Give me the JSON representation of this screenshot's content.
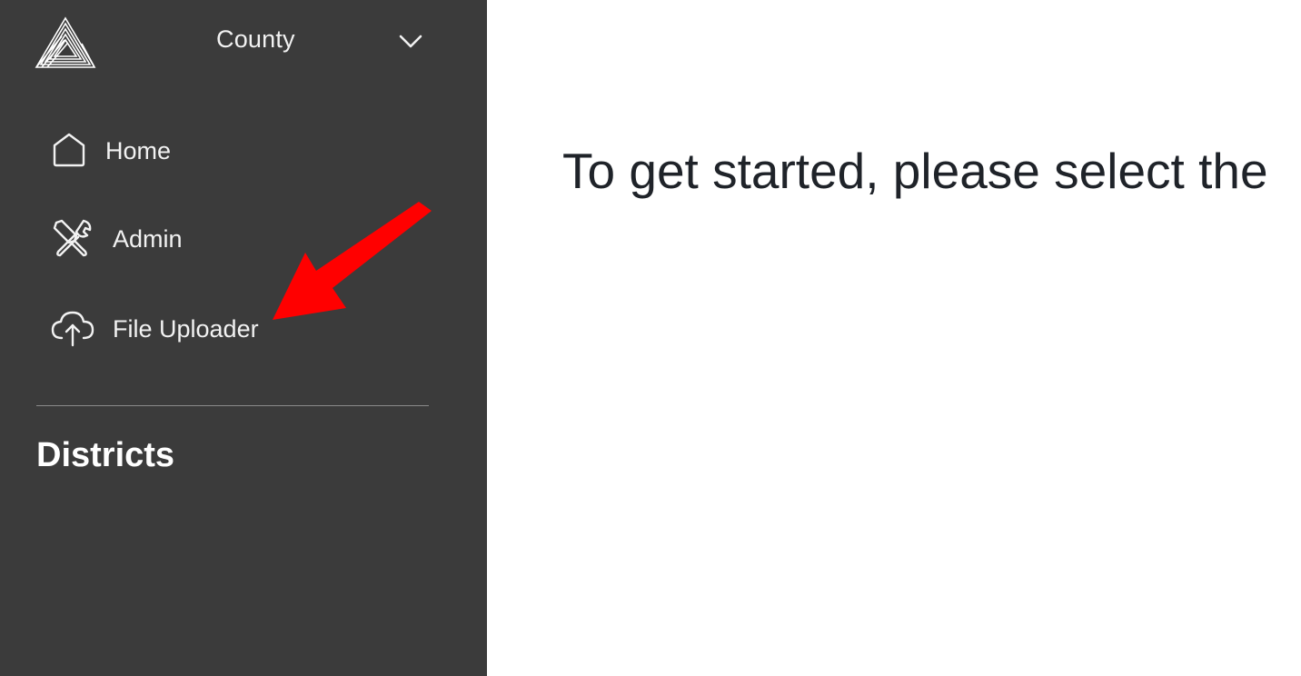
{
  "sidebar": {
    "county_selector": {
      "value": "County",
      "icon": "chevron-down-icon"
    },
    "nav_items": [
      {
        "label": "Home",
        "icon": "home-icon"
      },
      {
        "label": "Admin",
        "icon": "tools-icon"
      },
      {
        "label": "File Uploader",
        "icon": "cloud-upload-icon"
      }
    ],
    "section_heading": "Districts"
  },
  "main": {
    "intro_text": "To get started, please select the"
  },
  "colors": {
    "sidebar_bg": "#3b3b3b",
    "main_bg": "#ffffff",
    "text_dark": "#1f2329",
    "annotation_arrow": "#ff0000"
  }
}
